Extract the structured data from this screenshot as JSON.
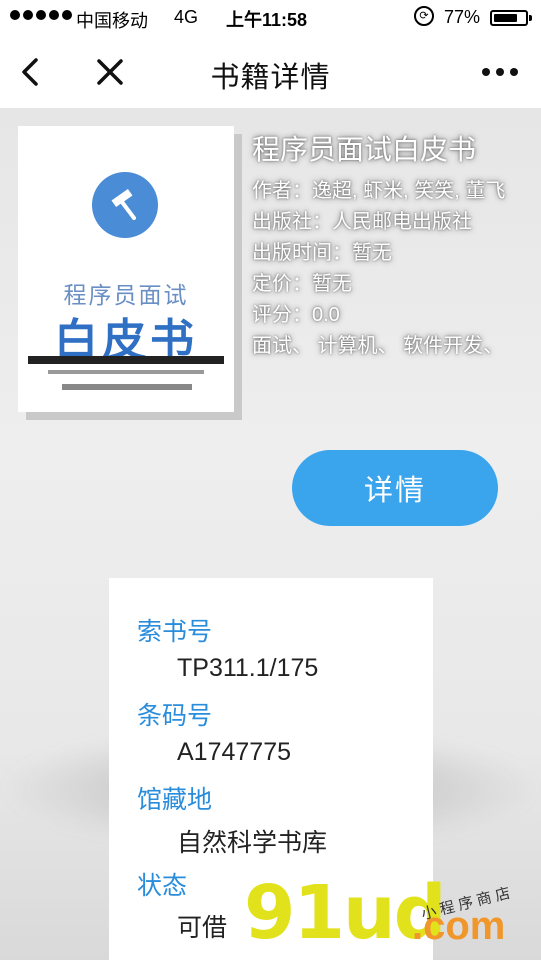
{
  "status_bar": {
    "carrier": "中国移动",
    "network": "4G",
    "time": "上午11:58",
    "battery": "77%",
    "battery_level": 0.77
  },
  "nav": {
    "title": "书籍详情",
    "icons": {
      "back": "chevron-left-icon",
      "close": "close-icon",
      "more": "more-icon"
    }
  },
  "book": {
    "cover": {
      "series": "程序员面试",
      "name": "白皮书"
    },
    "title": "程序员面试白皮书",
    "author": "作者：逸超, 虾米, 笑笑, 董飞",
    "publisher": "出版社：人民邮电出版社",
    "publish_time": "出版时间：暂无",
    "price": "定价：暂无",
    "rating": "评分：0.0",
    "tags": "面试、 计算机、 软件开发、"
  },
  "detail_button": "详情",
  "holdings": {
    "call_number_label": "索书号",
    "call_number": "TP311.1/175",
    "barcode_label": "条码号",
    "barcode": "A1747775",
    "location_label": "馆藏地",
    "location": "自然科学书库",
    "status_label": "状态",
    "status": "可借"
  },
  "watermark": {
    "brand": "91ud",
    "domain": ".com",
    "tagline": "小程序商店"
  },
  "colors": {
    "accent": "#3aa4ec",
    "label": "#2a8ddc"
  }
}
